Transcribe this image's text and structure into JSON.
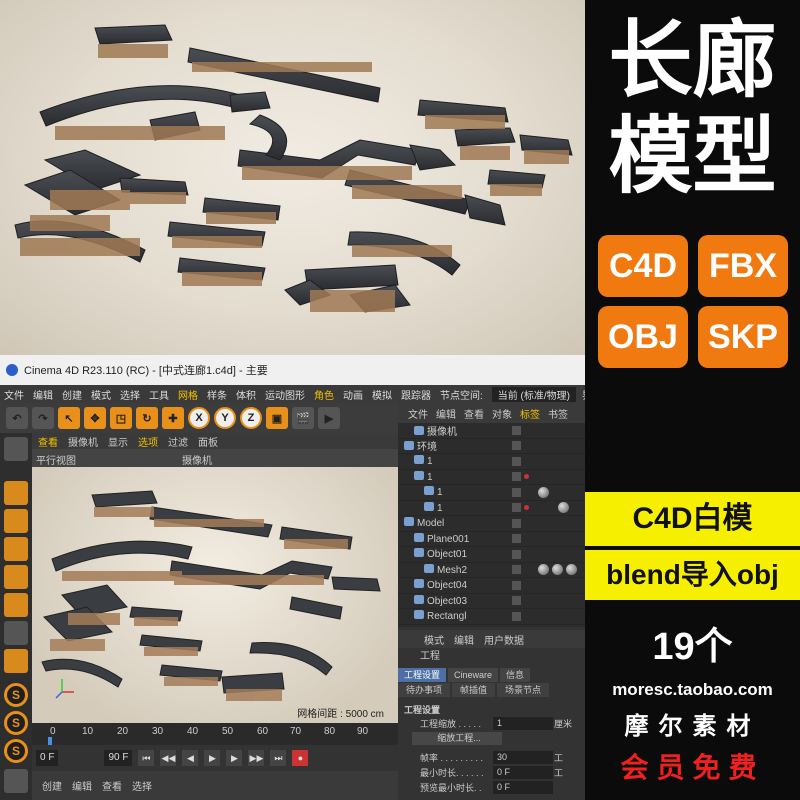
{
  "promo": {
    "title_line1": "长廊",
    "title_line2": "模型",
    "formats": [
      "C4D",
      "FBX",
      "OBJ",
      "SKP"
    ],
    "banner1": "C4D白模",
    "banner2": "blend导入obj",
    "count": "19个",
    "shop_url": "moresc.taobao.com",
    "brand": "摩尔素材",
    "vip": "会员免费",
    "colors": {
      "accent": "#f07a10",
      "banner": "#f6f000",
      "vip": "#f02020"
    }
  },
  "window": {
    "title": "Cinema 4D R23.110 (RC) - [中式连廊1.c4d] - 主要",
    "menu": [
      "文件",
      "编辑",
      "创建",
      "模式",
      "选择",
      "工具",
      "网格",
      "样条",
      "体积",
      "运动图形",
      "角色",
      "动画",
      "模拟",
      "跟踪器"
    ],
    "menu_highlight": [
      "网格",
      "角色"
    ],
    "node_space_label": "节点空间:",
    "node_space_value": "当前 (标准/物理)",
    "layout_label": "界面"
  },
  "viewport": {
    "menu": [
      "查看",
      "摄像机",
      "显示",
      "选项",
      "过滤",
      "面板"
    ],
    "menu_highlight": [
      "查看",
      "选项"
    ],
    "view_name": "平行视图",
    "camera_label": "摄像机",
    "grid_status": "网格间距 : 5000 cm"
  },
  "timeline": {
    "ticks": [
      "0",
      "10",
      "20",
      "30",
      "40",
      "50",
      "60",
      "70",
      "80",
      "90"
    ],
    "start_field": "0 F",
    "end_field": "90 F",
    "current_field": "0 F"
  },
  "material_bar": {
    "items": [
      "创建",
      "编辑",
      "查看",
      "选择"
    ]
  },
  "object_manager": {
    "menu": [
      "文件",
      "编辑",
      "查看",
      "对象",
      "标签",
      "书签"
    ],
    "menu_highlight": [
      "标签"
    ],
    "rows": [
      {
        "name": "摄像机",
        "indent": 1
      },
      {
        "name": "环境",
        "indent": 1
      },
      {
        "name": "1",
        "indent": 2
      },
      {
        "name": "1",
        "indent": 2
      },
      {
        "name": "1",
        "indent": 3
      },
      {
        "name": "1",
        "indent": 3
      },
      {
        "name": "Model",
        "indent": 1
      },
      {
        "name": "Plane001",
        "indent": 2
      },
      {
        "name": "Object01",
        "indent": 2
      },
      {
        "name": "Mesh2",
        "indent": 3
      },
      {
        "name": "Object04",
        "indent": 2
      },
      {
        "name": "Object03",
        "indent": 2
      },
      {
        "name": "Rectangl",
        "indent": 2
      }
    ]
  },
  "attributes": {
    "menu": [
      "模式",
      "编辑",
      "用户数据"
    ],
    "title": "工程",
    "tabs1": [
      "工程设置",
      "Cineware",
      "信息"
    ],
    "tabs2": [
      "待办事项",
      "帧插值",
      "场景节点"
    ],
    "section": "工程设置",
    "rows": [
      {
        "label": "工程缩放 . . . . .",
        "value": "1",
        "unit": "厘米"
      },
      {
        "label": "",
        "value": "缩放工程...",
        "unit": ""
      },
      {
        "label": "帧率 . . . . . . . . .",
        "value": "30",
        "unit": "工"
      },
      {
        "label": "最小时长. . . . . .",
        "value": "0 F",
        "unit": "工"
      },
      {
        "label": "预览最小时长. .",
        "value": "0 F",
        "unit": ""
      }
    ]
  }
}
